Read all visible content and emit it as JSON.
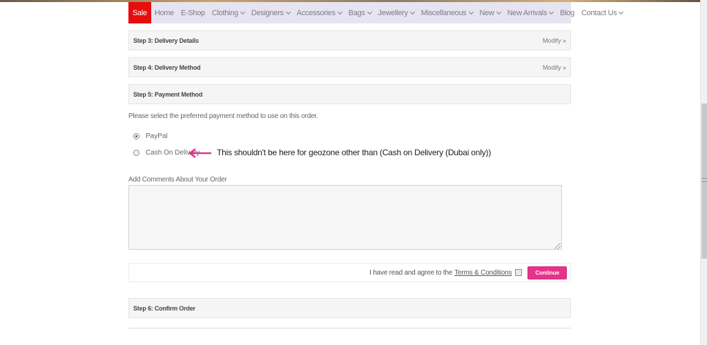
{
  "nav": {
    "items": [
      {
        "label": "Sale",
        "dropdown": false
      },
      {
        "label": "Home",
        "dropdown": false
      },
      {
        "label": "E-Shop",
        "dropdown": false
      },
      {
        "label": "Clothing",
        "dropdown": true
      },
      {
        "label": "Designers",
        "dropdown": true
      },
      {
        "label": "Accessories",
        "dropdown": true
      },
      {
        "label": "Bags",
        "dropdown": true
      },
      {
        "label": "Jewellery",
        "dropdown": true
      },
      {
        "label": "Miscellaneous",
        "dropdown": true
      },
      {
        "label": "New",
        "dropdown": true
      },
      {
        "label": "New Arrivals",
        "dropdown": true
      },
      {
        "label": "Blog",
        "dropdown": false
      },
      {
        "label": "Contact Us",
        "dropdown": true
      }
    ]
  },
  "steps": {
    "step3": {
      "title": "Step 3: Delivery Details",
      "modify": "Modify »"
    },
    "step4": {
      "title": "Step 4: Delivery Method",
      "modify": "Modify »"
    },
    "step5": {
      "title": "Step 5: Payment Method"
    },
    "step6": {
      "title": "Step 6: Confirm Order"
    }
  },
  "payment": {
    "intro": "Please select the preferred payment method to use on this order.",
    "options": [
      {
        "label": "PayPal",
        "selected": true
      },
      {
        "label": "Cash On Delivery",
        "selected": false
      }
    ]
  },
  "annotation": {
    "text": "This shouldn't be here for geozone other than (Cash on Delivery (Dubai only))",
    "arrow_color": "#e0338c"
  },
  "comments": {
    "label": "Add Comments About Your Order",
    "value": ""
  },
  "agreement": {
    "text": "I have read and agree to the",
    "terms_link": "Terms & Conditions",
    "checked": false,
    "continue_label": "Continue"
  },
  "colors": {
    "nav_bg": "#e7e4f1",
    "sale_bg": "#e80d0d",
    "continue_bg": "#e6338a",
    "radio_selected": "#1e5fa8"
  }
}
